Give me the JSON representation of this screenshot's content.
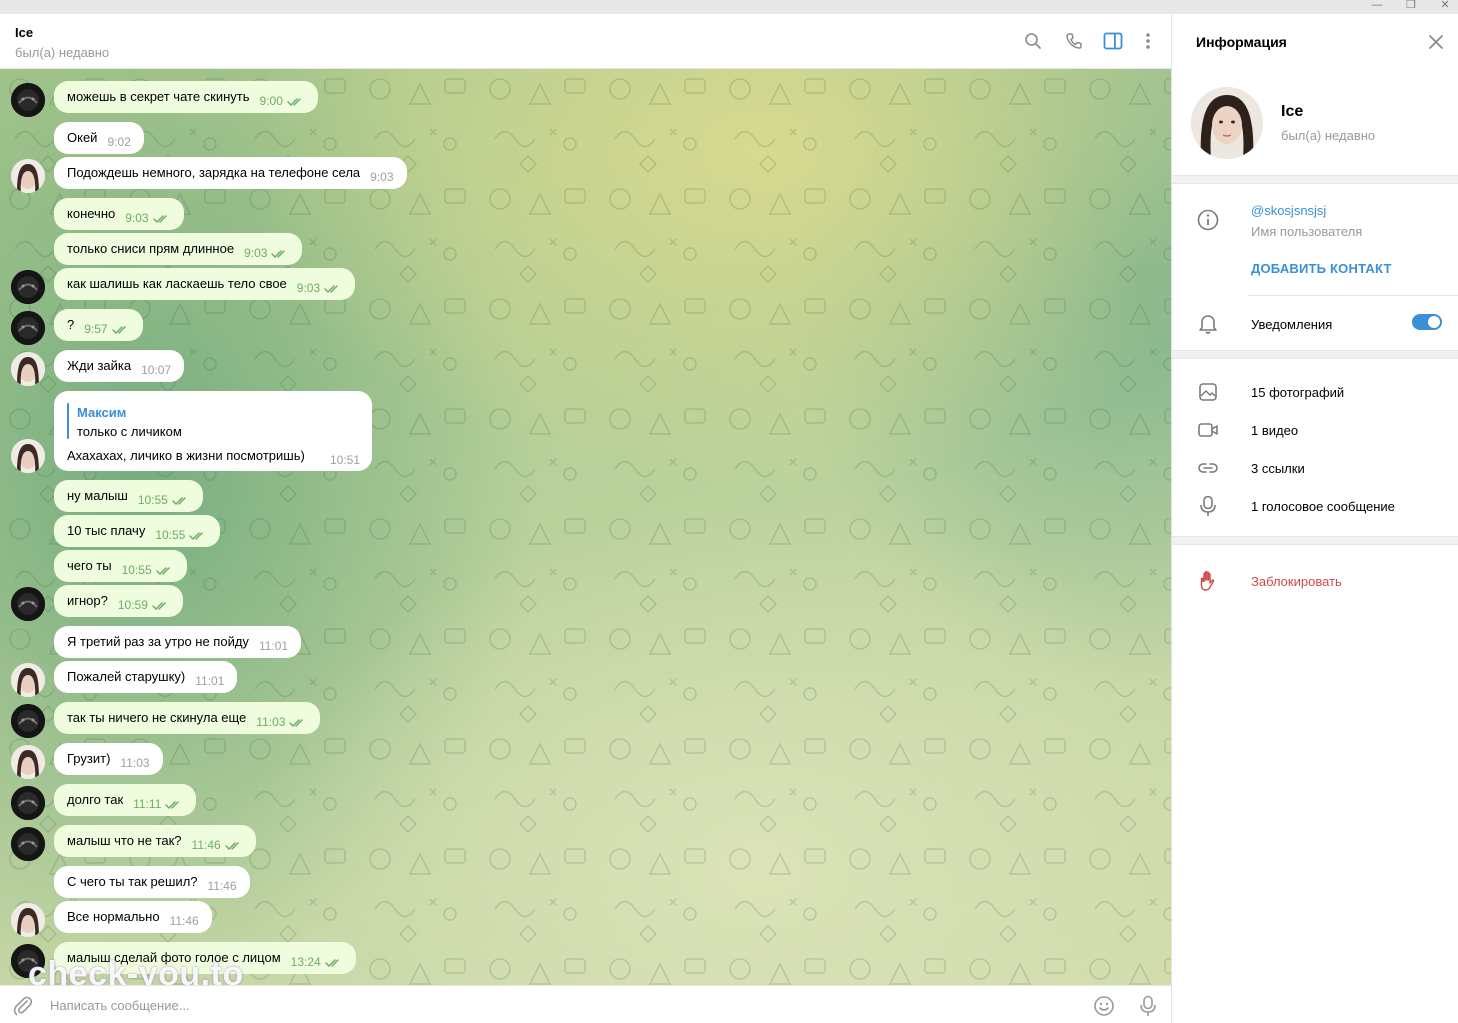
{
  "window": {
    "minimize": "—",
    "maximize": "❐",
    "close": "✕"
  },
  "header": {
    "title": "Ice",
    "status": "был(а) недавно"
  },
  "messages": [
    {
      "side": "out",
      "text": "можешь в секрет чате скинуть",
      "time": "9:00",
      "avatar": "dark"
    },
    {
      "side": "in",
      "text": "Окей",
      "time": "9:02",
      "avatar": "none"
    },
    {
      "side": "in",
      "text": "Подождешь немного, зарядка на телефоне села",
      "time": "9:03",
      "avatar": "girl"
    },
    {
      "side": "out",
      "text": "конечно",
      "time": "9:03",
      "avatar": "none"
    },
    {
      "side": "out",
      "text": "только сниси прям длинное",
      "time": "9:03",
      "avatar": "none"
    },
    {
      "side": "out",
      "text": "как шалишь как ласкаешь тело свое",
      "time": "9:03",
      "avatar": "dark"
    },
    {
      "side": "out",
      "text": "?",
      "time": "9:57",
      "avatar": "dark"
    },
    {
      "side": "in",
      "text": "Жди зайка",
      "time": "10:07",
      "avatar": "girl"
    },
    {
      "side": "out",
      "text": "ну малыш",
      "time": "10:55",
      "avatar": "none"
    },
    {
      "side": "out",
      "text": "10 тыс плачу",
      "time": "10:55",
      "avatar": "none"
    },
    {
      "side": "out",
      "text": "чего ты",
      "time": "10:55",
      "avatar": "none"
    },
    {
      "side": "out",
      "text": "игнор?",
      "time": "10:59",
      "avatar": "dark"
    },
    {
      "side": "in",
      "text": "Я третий раз за утро не пойду",
      "time": "11:01",
      "avatar": "none"
    },
    {
      "side": "in",
      "text": "Пожалей старушку)",
      "time": "11:01",
      "avatar": "girl"
    },
    {
      "side": "out",
      "text": "так ты ничего не скинула еще",
      "time": "11:03",
      "avatar": "dark"
    },
    {
      "side": "in",
      "text": "Грузит)",
      "time": "11:03",
      "avatar": "girl"
    },
    {
      "side": "out",
      "text": "долго так",
      "time": "11:11",
      "avatar": "dark"
    },
    {
      "side": "out",
      "text": "малыш что не так?",
      "time": "11:46",
      "avatar": "dark"
    },
    {
      "side": "in",
      "text": "С чего ты так решил?",
      "time": "11:46",
      "avatar": "none"
    },
    {
      "side": "in",
      "text": "Все нормально",
      "time": "11:46",
      "avatar": "girl"
    },
    {
      "side": "out",
      "text": "малыш сделай фото голое с лицом",
      "time": "13:24",
      "avatar": "dark"
    }
  ],
  "reply_message": {
    "reply_to_name": "Максим",
    "reply_to_text": "только с личиком",
    "text": "Ахахахах, личико в жизни посмотришь)",
    "time": "10:51"
  },
  "watermark": "check-you.to",
  "composer": {
    "placeholder": "Написать сообщение..."
  },
  "info_panel": {
    "title": "Информация",
    "name": "Ice",
    "status": "был(а) недавно",
    "username": "@skosjsnsjsj",
    "username_label": "Имя пользователя",
    "add_contact": "ДОБАВИТЬ КОНТАКТ",
    "notifications_label": "Уведомления",
    "notifications_on": true,
    "media": {
      "photos": "15 фотографий",
      "videos": "1 видео",
      "links": "3 ссылки",
      "voice": "1 голосовое сообщение"
    },
    "block": "Заблокировать"
  },
  "colors": {
    "accent": "#3a8fd6",
    "outgoing_bubble": "#effdde",
    "incoming_bubble": "#ffffff",
    "outgoing_time": "#6cae62",
    "danger": "#d24949"
  },
  "icons": {
    "attach": "paperclip-icon",
    "emoji": "emoji-icon",
    "mic": "microphone-icon",
    "search": "search-icon",
    "call": "phone-icon",
    "sidebar": "sidebar-toggle-icon",
    "more": "more-vertical-icon",
    "close": "close-icon",
    "info": "info-icon",
    "bell": "bell-icon",
    "photo": "photo-icon",
    "video": "video-icon",
    "link": "link-icon",
    "voice": "microphone-icon",
    "block": "hand-icon"
  }
}
